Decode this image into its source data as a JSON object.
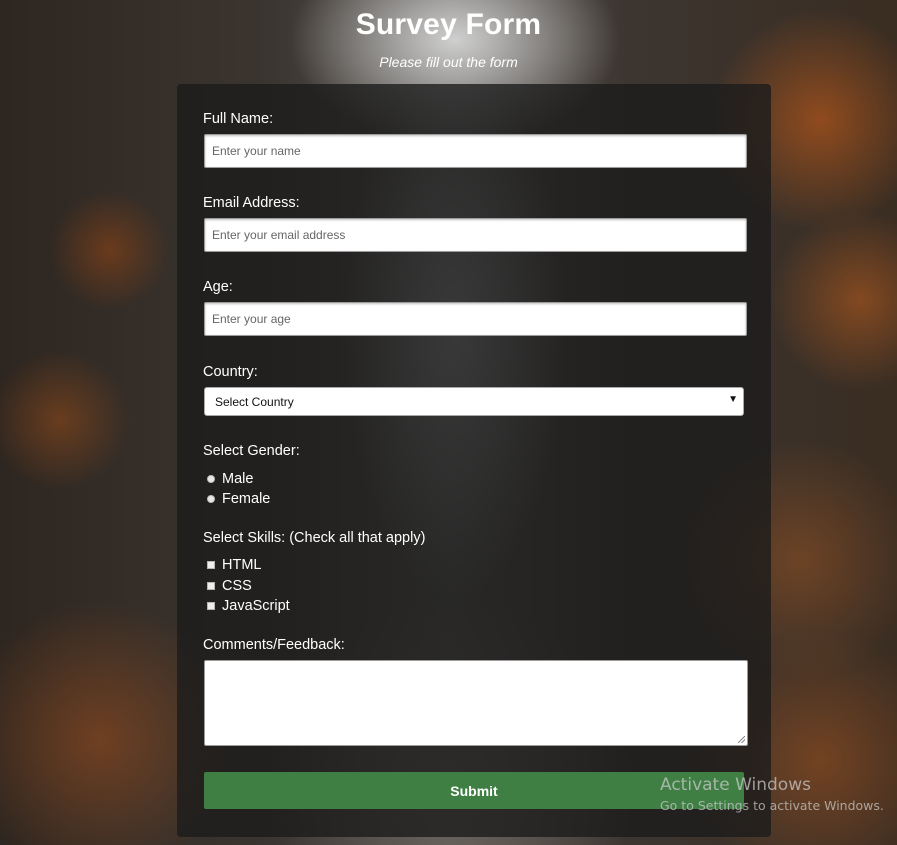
{
  "header": {
    "title": "Survey Form",
    "description": "Please fill out the form"
  },
  "form": {
    "name": {
      "label": "Full Name:",
      "placeholder": "Enter your name",
      "value": ""
    },
    "email": {
      "label": "Email Address:",
      "placeholder": "Enter your email address",
      "value": ""
    },
    "age": {
      "label": "Age:",
      "placeholder": "Enter your age",
      "value": ""
    },
    "country": {
      "label": "Country:",
      "selected": "Select Country",
      "arrow_icon": "dropdown-triangle"
    },
    "gender": {
      "label": "Select Gender:",
      "options": [
        "Male",
        "Female"
      ]
    },
    "skills": {
      "label": "Select Skills: (Check all that apply)",
      "options": [
        "HTML",
        "CSS",
        "JavaScript"
      ]
    },
    "comments": {
      "label": "Comments/Feedback:",
      "value": ""
    },
    "submit_label": "Submit"
  },
  "watermark": {
    "title": "Activate Windows",
    "subtitle": "Go to Settings to activate Windows."
  },
  "colors": {
    "submit_button": "#3f7f44",
    "card_background": "rgba(27,27,27,0.78)"
  }
}
